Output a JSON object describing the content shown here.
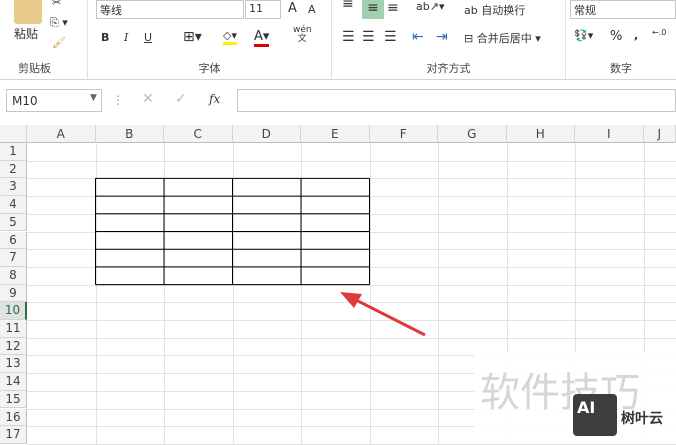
{
  "ribbon": {
    "clipboard": {
      "paste": "粘贴",
      "label": "剪贴板"
    },
    "font": {
      "name": "等线",
      "size": "11",
      "bold": "B",
      "italic": "I",
      "underline": "U",
      "grow": "A",
      "shrink": "A",
      "phonetic": "wén",
      "label": "字体"
    },
    "alignment": {
      "wrap": "自动换行",
      "merge": "合并后居中",
      "label": "对齐方式"
    },
    "number": {
      "format": "常规",
      "percent": "%",
      "comma": ",",
      "label": "数字"
    }
  },
  "formula_bar": {
    "name_box": "M10",
    "fx": "fx",
    "value": ""
  },
  "sheet": {
    "columns": [
      "A",
      "B",
      "C",
      "D",
      "E",
      "F",
      "G",
      "H",
      "I",
      "J"
    ],
    "rows": [
      "1",
      "2",
      "3",
      "4",
      "5",
      "6",
      "7",
      "8",
      "9",
      "10",
      "11",
      "12",
      "13",
      "14",
      "15",
      "16",
      "17"
    ],
    "active_row": "10"
  },
  "watermark": {
    "text": "软件技巧",
    "logo": "AI",
    "brand": "树叶云"
  },
  "colors": {
    "arrow": "#e0393b",
    "green": "#217346"
  }
}
